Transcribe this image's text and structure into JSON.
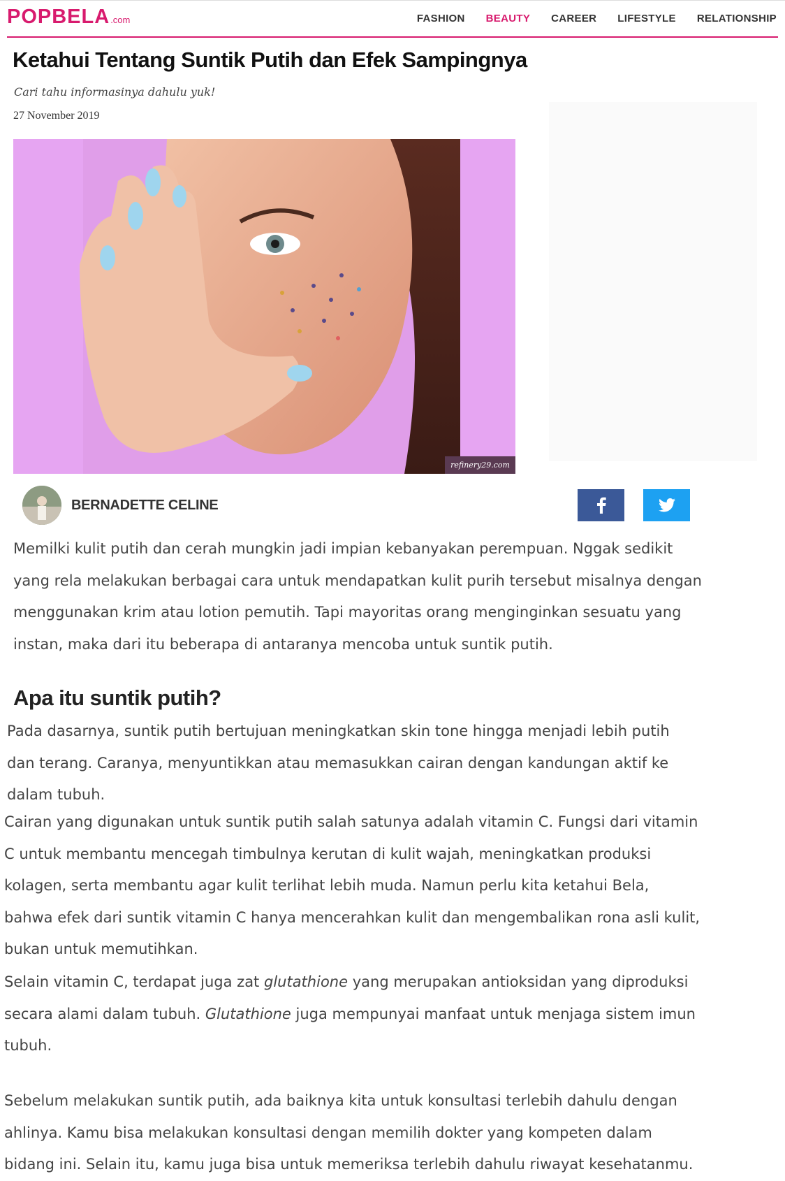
{
  "header": {
    "logo_main": "POPBELA",
    "logo_suffix": ".com",
    "nav": [
      "FASHION",
      "BEAUTY",
      "CAREER",
      "LIFESTYLE",
      "RELATIONSHIP"
    ],
    "active_nav": "BEAUTY",
    "brand_color": "#d81b6e"
  },
  "article": {
    "title": "Ketahui Tentang Suntik Putih dan Efek Sampingnya",
    "subtitle": "Cari tahu informasinya dahulu yuk!",
    "date": "27 November 2019",
    "image_credit": "refinery29.com",
    "author": "BERNADETTE CELINE",
    "share": {
      "facebook_icon": "facebook-icon",
      "twitter_icon": "twitter-icon",
      "facebook_color": "#3b5998",
      "twitter_color": "#1da1f2"
    },
    "p1": [
      "Memilki kulit putih dan cerah mungkin jadi impian kebanyakan perempuan. Nggak sedikit",
      "yang rela melakukan berbagai cara untuk mendapatkan kulit purih tersebut misalnya dengan",
      "menggunakan krim atau lotion pemutih. Tapi mayoritas orang menginginkan sesuatu yang",
      "instan, maka dari itu beberapa di antaranya mencoba untuk suntik putih."
    ],
    "heading": "Apa itu suntik putih?",
    "p2": [
      "Pada dasarnya, suntik putih bertujuan meningkatkan skin tone hingga menjadi lebih putih",
      "dan terang. Caranya, menyuntikkan atau memasukkan cairan dengan kandungan aktif ke",
      "dalam tubuh."
    ],
    "p3": [
      "Cairan yang digunakan untuk suntik putih salah satunya adalah vitamin C. Fungsi dari vitamin",
      "C untuk membantu mencegah timbulnya kerutan di kulit wajah, meningkatkan produksi",
      "kolagen, serta membantu agar kulit terlihat lebih muda. Namun perlu kita ketahui Bela,",
      "bahwa efek dari suntik vitamin C hanya mencerahkan kulit dan mengembalikan rona asli kulit,",
      "bukan untuk memutihkan."
    ],
    "p4": {
      "l1a": "Selain vitamin C, terdapat juga zat ",
      "l1em": "glutathione",
      "l1b": " yang merupakan antioksidan yang diproduksi",
      "l2a": "secara alami dalam tubuh. ",
      "l2em": "Glutathione",
      "l2b": " juga mempunyai manfaat untuk menjaga sistem imun",
      "l3": "tubuh."
    },
    "p5": [
      "Sebelum melakukan suntik putih, ada baiknya kita untuk konsultasi terlebih dahulu dengan",
      "ahlinya. Kamu bisa melakukan konsultasi dengan memilih dokter yang kompeten dalam",
      "bidang ini. Selain itu, kamu juga bisa untuk memeriksa terlebih dahulu riwayat kesehatanmu."
    ]
  }
}
